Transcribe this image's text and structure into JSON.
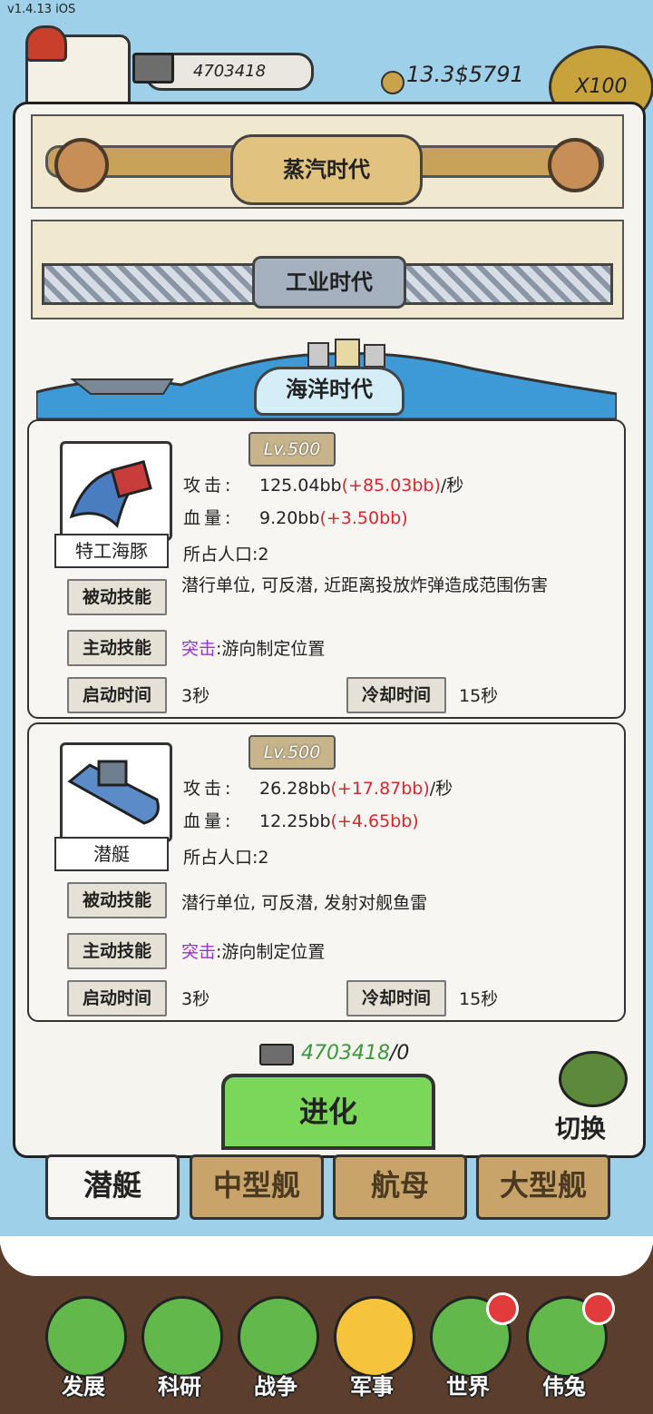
{
  "version": "v1.4.13 iOS",
  "resources": {
    "ingot_count": "4703418",
    "money": "13.3$5791",
    "multiplier": "X100"
  },
  "eras": [
    "蒸汽时代",
    "工业时代",
    "海洋时代"
  ],
  "units": [
    {
      "name": "特工海豚",
      "level": "Lv.500",
      "attack_label": "攻击:",
      "attack_value": "125.04bb",
      "attack_bonus": "(+85.03bb)",
      "attack_unit": "/秒",
      "hp_label": "血量:",
      "hp_value": "9.20bb",
      "hp_bonus": "(+3.50bb)",
      "population": "所占人口:2",
      "passive_label": "被动技能",
      "passive_desc": "潜行单位, 可反潜, 近距离投放炸弹造成范围伤害",
      "active_label": "主动技能",
      "active_name": "突击",
      "active_desc": ":游向制定位置",
      "start_label": "启动时间",
      "start_value": "3秒",
      "cooldown_label": "冷却时间",
      "cooldown_value": "15秒"
    },
    {
      "name": "潜艇",
      "level": "Lv.500",
      "attack_label": "攻击:",
      "attack_value": "26.28bb",
      "attack_bonus": "(+17.87bb)",
      "attack_unit": "/秒",
      "hp_label": "血量:",
      "hp_value": "12.25bb",
      "hp_bonus": "(+4.65bb)",
      "population": "所占人口:2",
      "passive_label": "被动技能",
      "passive_desc": "潜行单位, 可反潜, 发射对舰鱼雷",
      "active_label": "主动技能",
      "active_name": "突击",
      "active_desc": ":游向制定位置",
      "start_label": "启动时间",
      "start_value": "3秒",
      "cooldown_label": "冷却时间",
      "cooldown_value": "15秒"
    }
  ],
  "cost": {
    "owned": "4703418",
    "required": "/0"
  },
  "evolve_label": "进化",
  "switch_label": "切换",
  "tabs": [
    "潜艇",
    "中型舰",
    "航母",
    "大型舰"
  ],
  "nav": [
    {
      "label": "发展",
      "icon": "arrow-up-icon"
    },
    {
      "label": "科研",
      "icon": "flask-icon"
    },
    {
      "label": "战争",
      "icon": "swords-icon"
    },
    {
      "label": "军事",
      "icon": "helmet-icon"
    },
    {
      "label": "世界",
      "icon": "globe-icon"
    },
    {
      "label": "伟兔",
      "icon": "portrait-icon"
    }
  ],
  "colors": {
    "bonus": "#d4282c",
    "skill": "#9b30d2",
    "evolve": "#7ad75a",
    "tab_inactive": "#c9a46a"
  }
}
